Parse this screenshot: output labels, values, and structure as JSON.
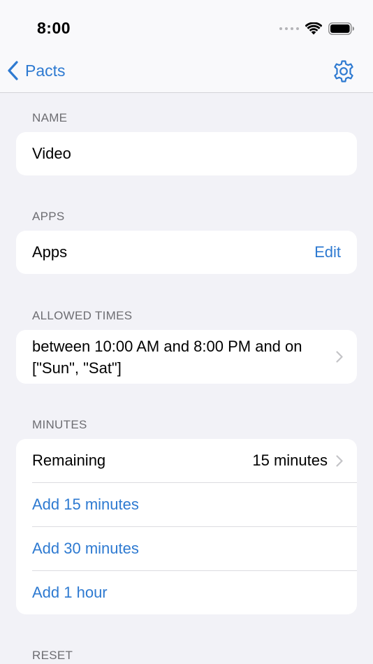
{
  "status": {
    "time": "8:00"
  },
  "nav": {
    "back_label": "Pacts"
  },
  "sections": {
    "name": {
      "header": "NAME",
      "value": "Video"
    },
    "apps": {
      "header": "APPS",
      "label": "Apps",
      "action": "Edit"
    },
    "allowed_times": {
      "header": "ALLOWED TIMES",
      "text": "between 10:00 AM and 8:00 PM and on [\"Sun\", \"Sat\"]"
    },
    "minutes": {
      "header": "MINUTES",
      "remaining_label": "Remaining",
      "remaining_value": "15 minutes",
      "actions": [
        "Add 15 minutes",
        "Add 30 minutes",
        "Add 1 hour"
      ]
    },
    "reset": {
      "header": "RESET"
    }
  },
  "colors": {
    "accent": "#2e7ad1",
    "background": "#f2f2f7",
    "card": "#ffffff",
    "secondary_text": "#6d6d72"
  }
}
